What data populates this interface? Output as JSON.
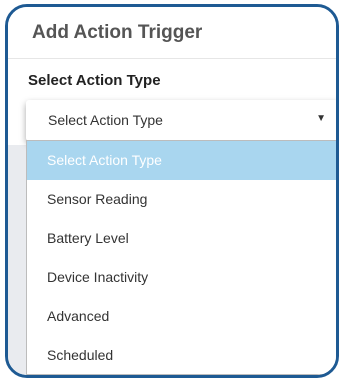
{
  "dialog": {
    "title": "Add Action Trigger",
    "field_label": "Select Action Type"
  },
  "select": {
    "value": "Select Action Type",
    "caret_icon": "▼",
    "options": [
      {
        "label": "Select Action Type",
        "selected": true
      },
      {
        "label": "Sensor Reading",
        "selected": false
      },
      {
        "label": "Battery Level",
        "selected": false
      },
      {
        "label": "Device Inactivity",
        "selected": false
      },
      {
        "label": "Advanced",
        "selected": false
      },
      {
        "label": "Scheduled",
        "selected": false
      }
    ]
  },
  "colors": {
    "frame_border": "#1e5a93",
    "selected_option_bg": "#a9d6ef",
    "panel_bg": "#e9ebef"
  }
}
